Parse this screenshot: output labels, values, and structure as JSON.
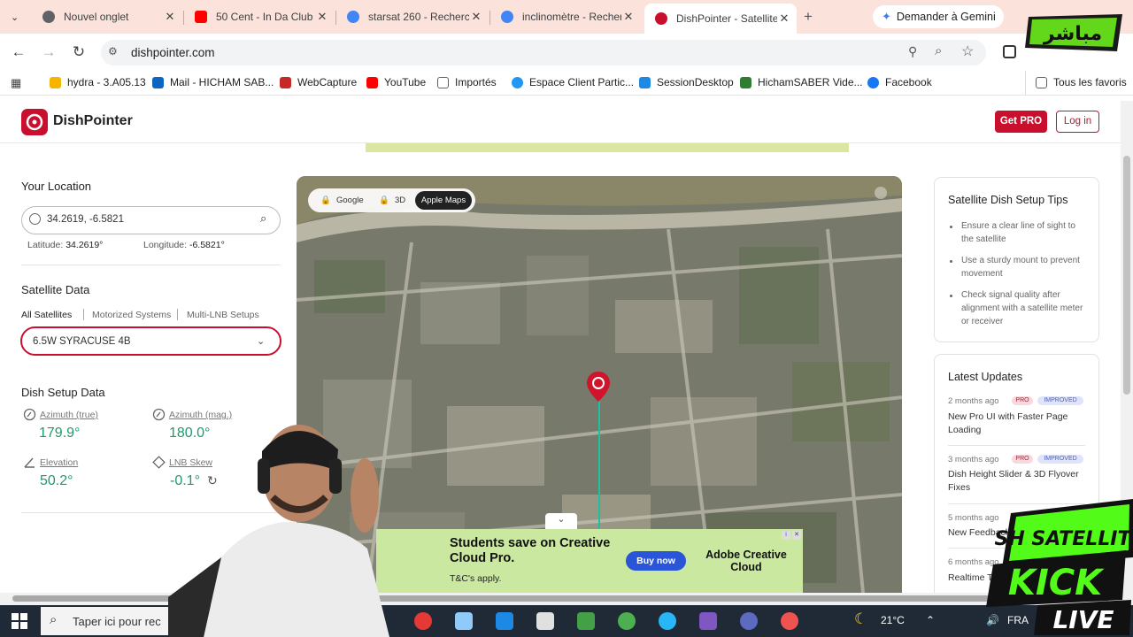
{
  "browser": {
    "tabs": [
      {
        "title": "Nouvel onglet",
        "favicon": "chrome-icon",
        "color": "#5f6368"
      },
      {
        "title": "50 Cent - In Da Club",
        "favicon": "youtube-icon",
        "color": "#ff0000"
      },
      {
        "title": "starsat 260 - Recherch",
        "favicon": "google-icon",
        "color": "#4285f4"
      },
      {
        "title": "inclinomètre - Recher",
        "favicon": "google-icon",
        "color": "#4285f4"
      },
      {
        "title": "DishPointer - Satellite",
        "favicon": "dishpointer-icon",
        "color": "#c8102e",
        "active": true
      }
    ],
    "new_tab": "+",
    "gemini_button": "Demander à Gemini",
    "url": "dishpointer.com",
    "bookmarks": [
      {
        "label": "hydra - 3.A05.13",
        "icon": "hydra-icon",
        "color": "#f4b400"
      },
      {
        "label": "Mail - HICHAM SAB...",
        "icon": "outlook-icon",
        "color": "#0a66c2"
      },
      {
        "label": "WebCapture",
        "icon": "webcapture-icon",
        "color": "#c62828"
      },
      {
        "label": "YouTube",
        "icon": "youtube-icon",
        "color": "#ff0000"
      },
      {
        "label": "Importés",
        "icon": "folder-icon",
        "color": "#5f6368"
      },
      {
        "label": "Espace Client Partic...",
        "icon": "bank-icon",
        "color": "#2196f3"
      },
      {
        "label": "SessionDesktop",
        "icon": "session-icon",
        "color": "#1e88e5"
      },
      {
        "label": "HichamSABER Vide...",
        "icon": "kick-icon",
        "color": "#2e7d32"
      },
      {
        "label": "Facebook",
        "icon": "facebook-icon",
        "color": "#1877f2"
      }
    ],
    "all_bookmarks": "Tous les favoris"
  },
  "site": {
    "logo": "DishPointer",
    "get_pro": "Get PRO",
    "login": "Log in"
  },
  "location": {
    "heading": "Your Location",
    "search_value": "34.2619, -6.5821",
    "latitude_label": "Latitude:",
    "latitude": "34.2619°",
    "longitude_label": "Longitude:",
    "longitude": "-6.5821°"
  },
  "satellite": {
    "heading": "Satellite Data",
    "filters": [
      "All Satellites",
      "Motorized Systems",
      "Multi-LNB Setups"
    ],
    "selected": "6.5W SYRACUSE 4B"
  },
  "dish": {
    "heading": "Dish Setup Data",
    "azimuth_true_label": "Azimuth (true)",
    "azimuth_true": "179.9°",
    "azimuth_mag_label": "Azimuth (mag.)",
    "azimuth_mag": "180.0°",
    "elevation_label": "Elevation",
    "elevation": "50.2°",
    "lnb_label": "LNB Skew",
    "lnb": "-0.1°"
  },
  "map": {
    "toggle": [
      "Google",
      "3D",
      "Apple Maps"
    ],
    "active": "Apple Maps"
  },
  "ad": {
    "headline": "Students save on Creative Cloud Pro.",
    "cta": "Buy now",
    "terms": "T&C's apply.",
    "brand": "Adobe Creative Cloud"
  },
  "tips": {
    "title": "Satellite Dish Setup Tips",
    "items": [
      "Ensure a clear line of sight to the satellite",
      "Use a sturdy mount to prevent movement",
      "Check signal quality after alignment with a satellite meter or receiver"
    ]
  },
  "updates": {
    "title": "Latest Updates",
    "items": [
      {
        "date": "2 months ago",
        "badges": [
          "PRO",
          "IMPROVED"
        ],
        "title": "New Pro UI with Faster Page Loading"
      },
      {
        "date": "3 months ago",
        "badges": [
          "PRO",
          "IMPROVED"
        ],
        "title": "Dish Height Slider & 3D Flyover Fixes"
      },
      {
        "date": "5 months ago",
        "badges": [],
        "title": "New Feedback"
      },
      {
        "date": "6 months ago",
        "badges": [],
        "title": "Realtime T"
      }
    ]
  },
  "taskbar": {
    "search_placeholder": "Taper ici pour rec",
    "weather": "21°C",
    "language": "FRA"
  },
  "overlays": {
    "top_right_logo": "مباشر",
    "stream_brand": "SH SATELLITE",
    "stream_kick": "KICK",
    "stream_live": "LIVE"
  }
}
